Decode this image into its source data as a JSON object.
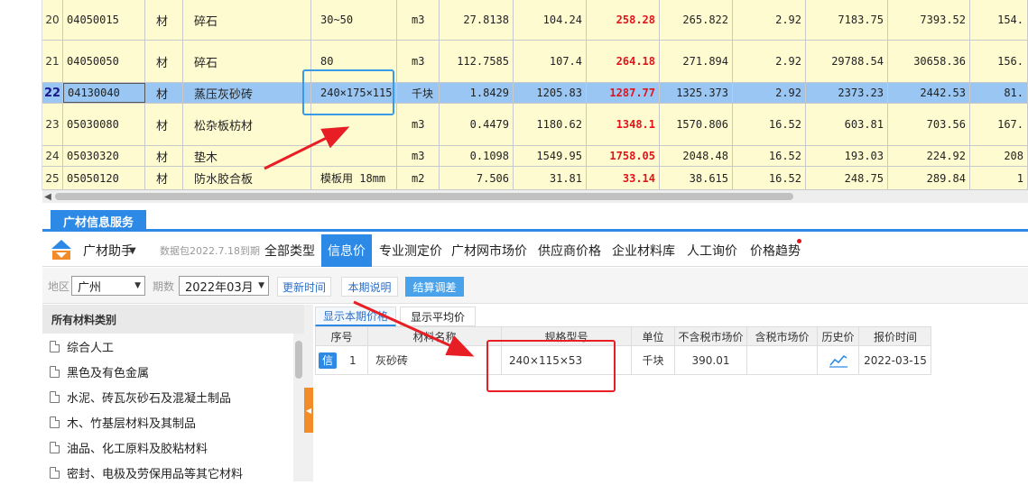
{
  "grid": {
    "rows": [
      {
        "rn": "20",
        "code": "04050015",
        "type": "材",
        "name": "碎石",
        "spec": "30~50",
        "unit": "m3",
        "qty": "27.8138",
        "c1": "104.24",
        "c2": "258.28",
        "c3": "265.822",
        "c4": "2.92",
        "c5": "7183.75",
        "c6": "7393.52",
        "c7": "154."
      },
      {
        "rn": "21",
        "code": "04050050",
        "type": "材",
        "name": "碎石",
        "spec": "80",
        "unit": "m3",
        "qty": "112.7585",
        "c1": "107.4",
        "c2": "264.18",
        "c3": "271.894",
        "c4": "2.92",
        "c5": "29788.54",
        "c6": "30658.36",
        "c7": "156."
      },
      {
        "rn": "22",
        "code": "04130040",
        "type": "材",
        "name": "蒸压灰砂砖",
        "spec": "240×175×115",
        "unit": "千块",
        "qty": "1.8429",
        "c1": "1205.83",
        "c2": "1287.77",
        "c3": "1325.373",
        "c4": "2.92",
        "c5": "2373.23",
        "c6": "2442.53",
        "c7": "81."
      },
      {
        "rn": "23",
        "code": "05030080",
        "type": "材",
        "name": "松杂板枋材",
        "spec": "",
        "unit": "m3",
        "qty": "0.4479",
        "c1": "1180.62",
        "c2": "1348.1",
        "c3": "1570.806",
        "c4": "16.52",
        "c5": "603.81",
        "c6": "703.56",
        "c7": "167."
      },
      {
        "rn": "24",
        "code": "05030320",
        "type": "材",
        "name": "垫木",
        "spec": "",
        "unit": "m3",
        "qty": "0.1098",
        "c1": "1549.95",
        "c2": "1758.05",
        "c3": "2048.48",
        "c4": "16.52",
        "c5": "193.03",
        "c6": "224.92",
        "c7": "208"
      },
      {
        "rn": "25",
        "code": "05050120",
        "type": "材",
        "name": "防水胶合板",
        "spec": "模板用 18mm",
        "unit": "m2",
        "qty": "7.506",
        "c1": "31.81",
        "c2": "33.14",
        "c3": "38.615",
        "c4": "16.52",
        "c5": "248.75",
        "c6": "289.84",
        "c7": "1"
      }
    ]
  },
  "panel": {
    "tab_label": "广材信息服务",
    "assistant_label": "广材助手",
    "package_label": "数据包2022.7.18到期",
    "nav_tabs": [
      "全部类型",
      "信息价",
      "专业测定价",
      "广材网市场价",
      "供应商价格",
      "企业材料库",
      "人工询价",
      "价格趋势"
    ],
    "filter": {
      "region_label": "地区",
      "region_value": "广州",
      "period_label": "期数",
      "period_value": "2022年03月",
      "btn_update": "更新时间",
      "btn_desc": "本期说明",
      "btn_settle": "结算调差"
    },
    "category_head": "所有材料类别",
    "categories": [
      "综合人工",
      "黑色及有色金属",
      "水泥、砖瓦灰砂石及混凝土制品",
      "木、竹基层材料及其制品",
      "油品、化工原料及胶粘材料",
      "密封、电极及劳保用品等其它材料"
    ],
    "result_tabs": [
      "显示本期价格",
      "显示平均价"
    ],
    "result_headers": [
      "序号",
      "材料名称",
      "规格型号",
      "单位",
      "不含税市场价",
      "含税市场价",
      "历史价",
      "报价时间"
    ],
    "result_row": {
      "badge": "信",
      "index": "1",
      "name": "灰砂砖",
      "spec": "240×115×53",
      "unit": "千块",
      "price_excl": "390.01",
      "price_incl": "",
      "date": "2022-03-15"
    }
  },
  "colors": {
    "accent": "#2c8ae6",
    "grid_bg": "#fffbd1",
    "selected_row": "#99c6f2",
    "price_red": "#e1141e",
    "annotation_red": "#e81e25",
    "annotation_blue": "#3a9ae8"
  }
}
